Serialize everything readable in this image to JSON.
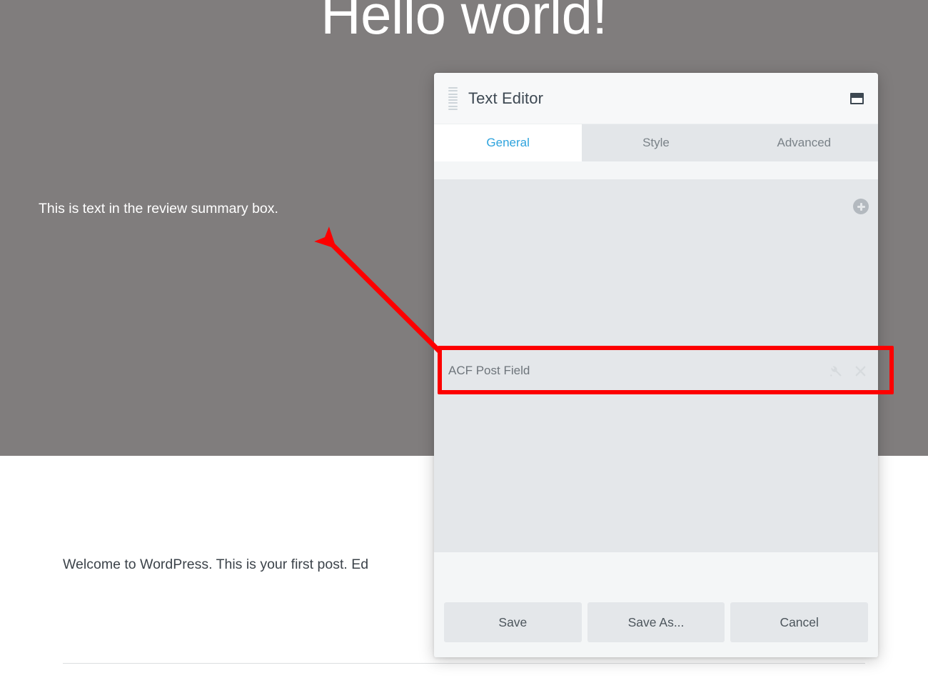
{
  "page": {
    "hero_title": "Hello world!",
    "review_summary_text": "This is text in the review summary box.",
    "post_paragraph": "Welcome to WordPress. This is your first post. Ed"
  },
  "modal": {
    "title": "Text Editor",
    "drag_handle_icon": "drag-handle-icon",
    "maximize_icon": "maximize-window-icon",
    "tabs": [
      {
        "label": "General",
        "active": true
      },
      {
        "label": "Style",
        "active": false
      },
      {
        "label": "Advanced",
        "active": false
      }
    ],
    "add_module_icon": "plus-circle-icon",
    "field_row": {
      "label": "ACF Post Field",
      "settings_icon": "wrench-icon",
      "remove_icon": "close-x-icon"
    },
    "footer": {
      "save_label": "Save",
      "save_as_label": "Save As...",
      "cancel_label": "Cancel"
    }
  },
  "colors": {
    "accent_blue": "#2ea3dd",
    "annotation_red": "#fd0000",
    "hero_gray": "#807d7d",
    "panel_gray": "#e4e7ea",
    "modal_bg": "#f4f6f7"
  }
}
